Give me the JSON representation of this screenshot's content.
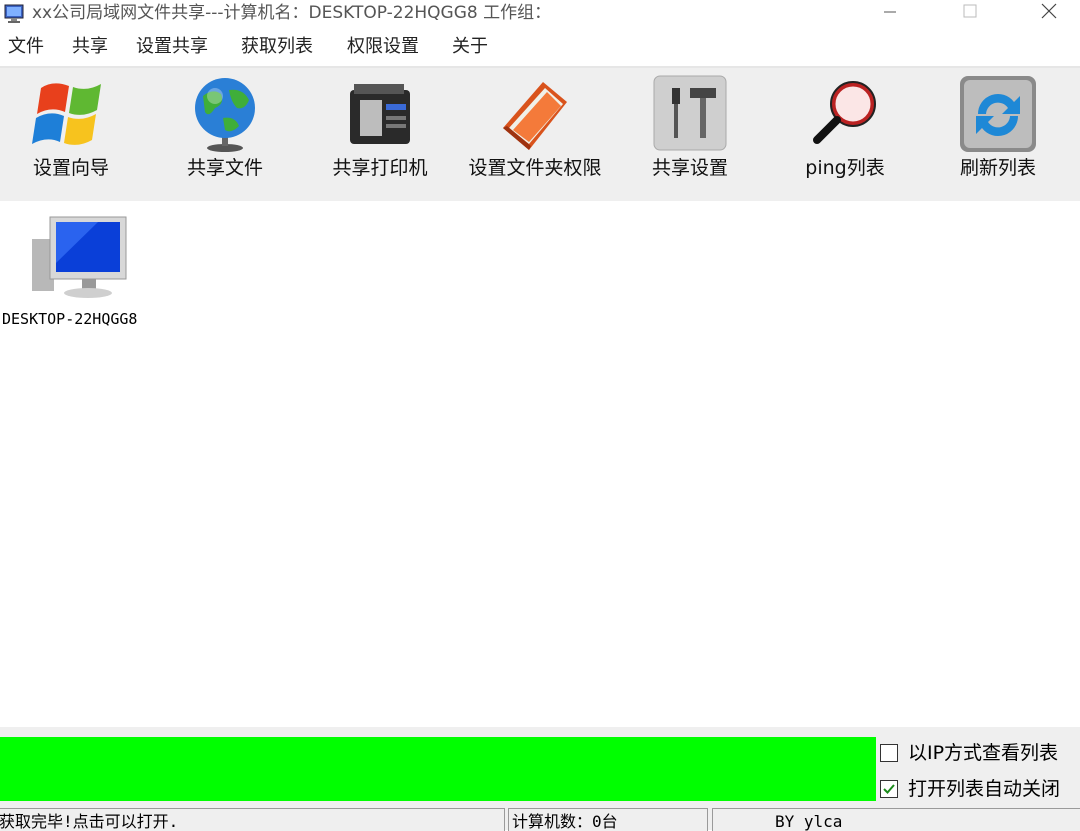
{
  "window": {
    "title": "xx公司局域网文件共享---计算机名：DESKTOP-22HQGG8  工作组：",
    "controls": [
      "minimize-icon",
      "maximize-icon",
      "close-icon"
    ]
  },
  "menu": {
    "items": [
      {
        "label": "文件"
      },
      {
        "label": "共享"
      },
      {
        "label": "设置共享"
      },
      {
        "label": "获取列表"
      },
      {
        "label": "权限设置"
      },
      {
        "label": "关于"
      }
    ]
  },
  "toolbar": {
    "items": [
      {
        "label": "设置向导",
        "icon": "windows-logo-icon"
      },
      {
        "label": "共享文件",
        "icon": "globe-icon"
      },
      {
        "label": "共享打印机",
        "icon": "printer-icon"
      },
      {
        "label": "设置文件夹权限",
        "icon": "folder-book-icon"
      },
      {
        "label": "共享设置",
        "icon": "tools-icon"
      },
      {
        "label": "ping列表",
        "icon": "magnifier-icon"
      },
      {
        "label": "刷新列表",
        "icon": "refresh-icon"
      }
    ]
  },
  "computers": [
    {
      "name": "DESKTOP-22HQGG8",
      "icon": "computer-monitor-icon"
    }
  ],
  "options": {
    "view_by_ip": {
      "label": "以IP方式查看列表",
      "checked": false
    },
    "auto_close": {
      "label": "打开列表自动关闭",
      "checked": true
    }
  },
  "progress": {
    "value": 1.0,
    "color": "#00ff00"
  },
  "status": {
    "message": "获取完毕!点击可以打开.",
    "count": "计算机数：0台",
    "author": "BY ylca"
  }
}
